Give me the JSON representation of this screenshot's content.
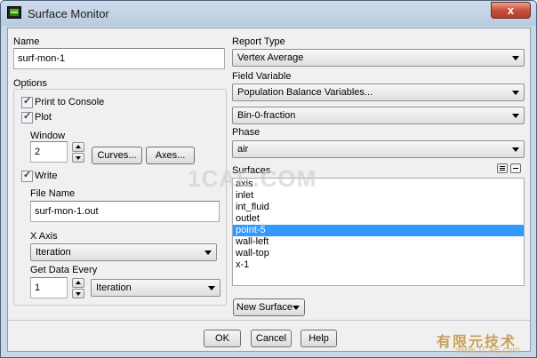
{
  "window": {
    "title": "Surface Monitor",
    "close_glyph": "x"
  },
  "name": {
    "label": "Name",
    "value": "surf-mon-1"
  },
  "options": {
    "label": "Options",
    "print_to_console": {
      "label": "Print to Console",
      "checked": true
    },
    "plot": {
      "label": "Plot",
      "checked": true
    },
    "window_label": "Window",
    "window_value": "2",
    "curves_button": "Curves...",
    "axes_button": "Axes...",
    "write": {
      "label": "Write",
      "checked": true
    },
    "file_name_label": "File Name",
    "file_name_value": "surf-mon-1.out",
    "x_axis_label": "X Axis",
    "x_axis_value": "Iteration",
    "get_data_every_label": "Get Data Every",
    "get_data_every_value": "1",
    "get_data_every_unit": "Iteration"
  },
  "report_type": {
    "label": "Report Type",
    "value": "Vertex Average"
  },
  "field_variable": {
    "label": "Field Variable",
    "category": "Population Balance Variables...",
    "variable": "Bin-0-fraction"
  },
  "phase": {
    "label": "Phase",
    "value": "air"
  },
  "surfaces": {
    "label": "Surfaces",
    "items": [
      "axis",
      "inlet",
      "int_fluid",
      "outlet",
      "point-5",
      "wall-left",
      "wall-top",
      "x-1"
    ],
    "selected": "point-5",
    "new_surface_button": "New Surface"
  },
  "footer": {
    "ok": "OK",
    "cancel": "Cancel",
    "help": "Help"
  },
  "watermarks": {
    "center": "1CAE.COM",
    "logo_cn": "有限元技术",
    "logo_url": "www.1CAE.com"
  },
  "colors": {
    "selection": "#3399ff",
    "titlebar": "#c9d6e6",
    "close": "#c7503a"
  },
  "icons": {
    "app": "fluent-app-icon",
    "close": "close-icon",
    "check": "checkmark-icon",
    "dropdown": "chevron-down-icon"
  }
}
